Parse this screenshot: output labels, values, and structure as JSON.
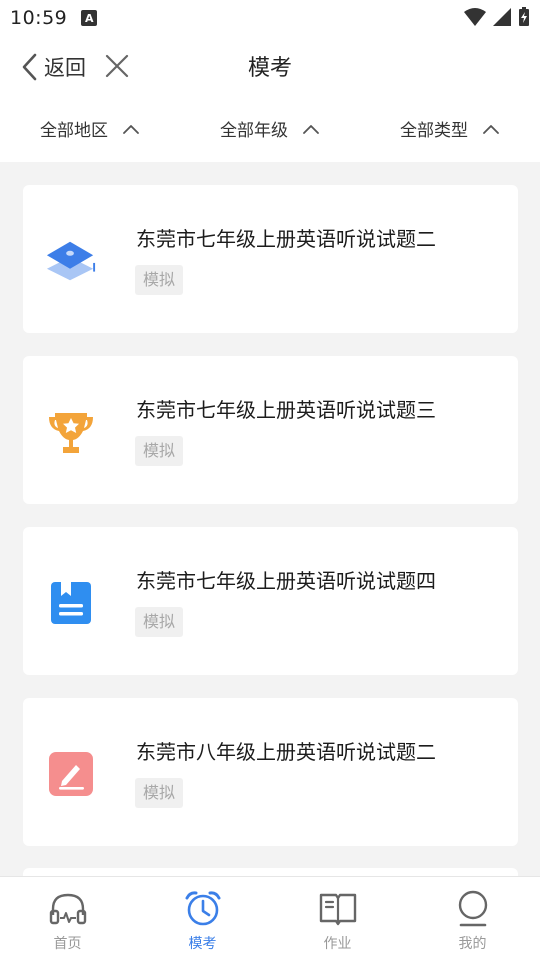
{
  "status": {
    "time": "10:59",
    "keyboard_badge": "A"
  },
  "nav": {
    "back_label": "返回",
    "title": "模考"
  },
  "filters": [
    {
      "label": "全部地区"
    },
    {
      "label": "全部年级"
    },
    {
      "label": "全部类型"
    }
  ],
  "papers": [
    {
      "title": "东莞市七年级上册英语听说试题二",
      "tag": "模拟",
      "icon": "graduation-cap-icon"
    },
    {
      "title": "东莞市七年级上册英语听说试题三",
      "tag": "模拟",
      "icon": "trophy-icon"
    },
    {
      "title": "东莞市七年级上册英语听说试题四",
      "tag": "模拟",
      "icon": "notebook-icon"
    },
    {
      "title": "东莞市八年级上册英语听说试题二",
      "tag": "模拟",
      "icon": "pen-edit-icon"
    }
  ],
  "tabs": [
    {
      "label": "首页",
      "icon": "headphones-icon",
      "active": false
    },
    {
      "label": "模考",
      "icon": "alarm-clock-icon",
      "active": true
    },
    {
      "label": "作业",
      "icon": "book-icon",
      "active": false
    },
    {
      "label": "我的",
      "icon": "user-icon",
      "active": false
    }
  ],
  "colors": {
    "accent": "#3b7fe8",
    "inactive": "#999999",
    "background": "#f3f3f3",
    "tag_bg": "#f0f0f0",
    "tag_text": "#a8a8a8"
  }
}
